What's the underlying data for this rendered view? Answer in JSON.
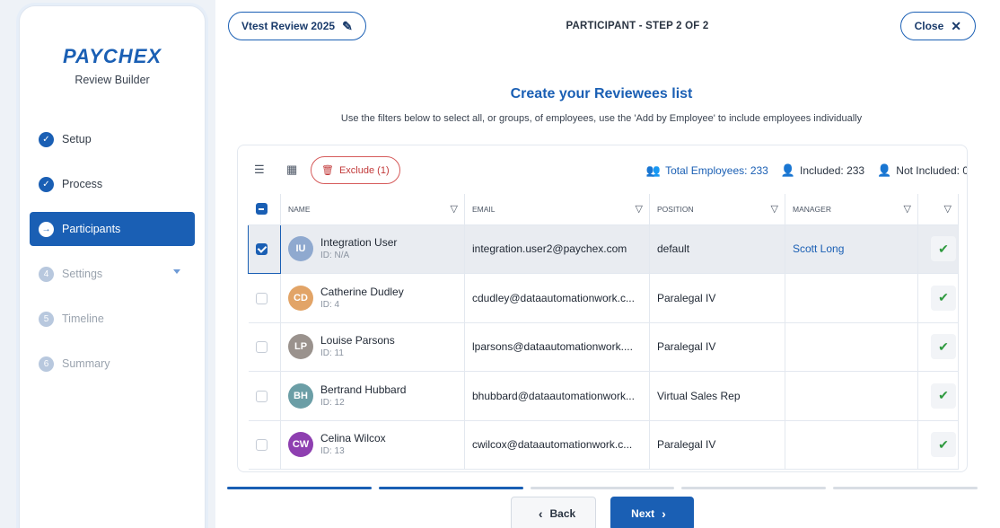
{
  "sidebar": {
    "logo": "PAYCHEX",
    "subtitle": "Review Builder",
    "steps": [
      {
        "num": "✓",
        "label": "Setup",
        "state": "done"
      },
      {
        "num": "✓",
        "label": "Process",
        "state": "done"
      },
      {
        "num": "→",
        "label": "Participants",
        "state": "active"
      },
      {
        "num": "4",
        "label": "Settings",
        "state": "pending"
      },
      {
        "num": "5",
        "label": "Timeline",
        "state": "pending"
      },
      {
        "num": "6",
        "label": "Summary",
        "state": "pending"
      }
    ]
  },
  "header": {
    "review_name": "Vtest Review 2025",
    "step_title": "PARTICIPANT - STEP 2 OF 2",
    "close_label": "Close"
  },
  "content": {
    "heading": "Create your Reviewees list",
    "description": "Use the filters below to select all, or groups, of employees, use the 'Add by Employee' to include employees individually"
  },
  "toolbar": {
    "exclude_label": "Exclude (1)",
    "total_label": "Total Employees: 233",
    "included_label": "Included: 233",
    "not_included_label": "Not Included: 0"
  },
  "table": {
    "columns": [
      "NAME",
      "EMAIL",
      "POSITION",
      "MANAGER"
    ],
    "rows": [
      {
        "initials": "IU",
        "color": "#8fa9cf",
        "name": "Integration User",
        "id": "ID: N/A",
        "email": "integration.user2@paychex.com",
        "position": "default",
        "manager": "Scott Long",
        "checked": true
      },
      {
        "initials": "CD",
        "color": "#e2a467",
        "name": "Catherine Dudley",
        "id": "ID: 4",
        "email": "cdudley@dataautomationwork.c...",
        "position": "Paralegal IV",
        "manager": "",
        "checked": false
      },
      {
        "initials": "LP",
        "color": "#9a928d",
        "name": "Louise Parsons",
        "id": "ID: 11",
        "email": "lparsons@dataautomationwork....",
        "position": "Paralegal IV",
        "manager": "",
        "checked": false
      },
      {
        "initials": "BH",
        "color": "#6b9ea6",
        "name": "Bertrand Hubbard",
        "id": "ID: 12",
        "email": "bhubbard@dataautomationwork...",
        "position": "Virtual Sales Rep",
        "manager": "",
        "checked": false
      },
      {
        "initials": "CW",
        "color": "#8e3fb0",
        "name": "Celina Wilcox",
        "id": "ID: 13",
        "email": "cwilcox@dataautomationwork.c...",
        "position": "Paralegal IV",
        "manager": "",
        "checked": false
      }
    ]
  },
  "footer": {
    "progress_segments_on": 2,
    "progress_segments_total": 5,
    "back_label": "Back",
    "next_label": "Next"
  },
  "colors": {
    "accent": "#1a5fb4",
    "exclude": "#c23a3a",
    "include_icon": "#2f9a3f"
  }
}
